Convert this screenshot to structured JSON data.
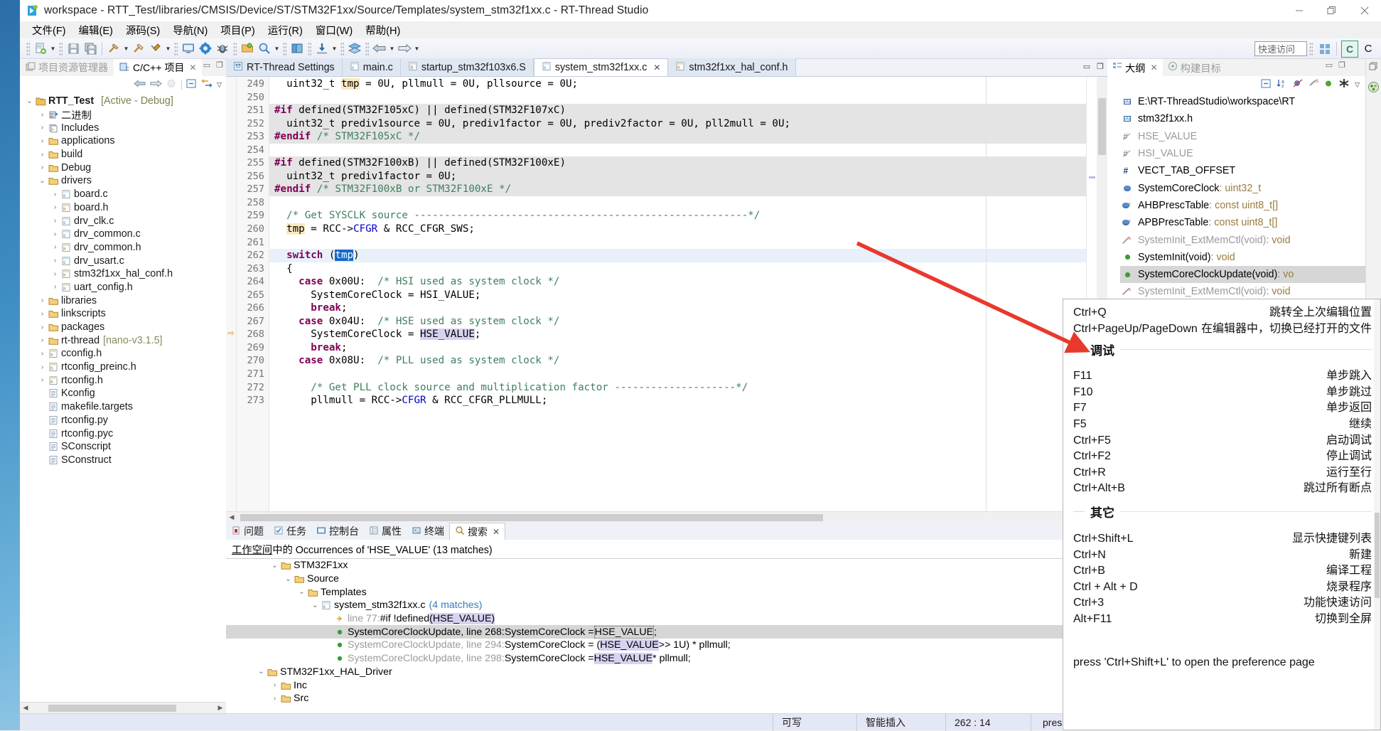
{
  "window": {
    "title": "workspace - RTT_Test/libraries/CMSIS/Device/ST/STM32F1xx/Source/Templates/system_stm32f1xx.c - RT-Thread Studio",
    "minimize": "—",
    "maximize": "❐",
    "close": "✕"
  },
  "menubar": {
    "items": [
      {
        "label": "文件(F)"
      },
      {
        "label": "编辑(E)"
      },
      {
        "label": "源码(S)"
      },
      {
        "label": "导航(N)"
      },
      {
        "label": "项目(P)"
      },
      {
        "label": "运行(R)"
      },
      {
        "label": "窗口(W)"
      },
      {
        "label": "帮助(H)"
      }
    ]
  },
  "toolbar": {
    "quick_access_placeholder": "快速访问",
    "icons": [
      "new-file-icon",
      "save-icon",
      "save-all-icon",
      "build-hammer-icon",
      "clean-icon",
      "build-config-icon",
      "terminal-icon",
      "settings-gear-icon",
      "debug-bug-icon",
      "open-resource-icon",
      "search-icon",
      "book-icon",
      "download-icon",
      "layers-icon",
      "back-arrow-icon",
      "forward-arrow-icon"
    ],
    "perspective_labels": [
      "C",
      "C"
    ]
  },
  "left_panel": {
    "tabs": [
      {
        "label": "项目资源管理器",
        "active": false,
        "icon": "project-explorer-icon"
      },
      {
        "label": "C/C++ 项目",
        "active": true,
        "icon": "cpp-project-icon"
      }
    ],
    "view_toolbar": [
      "back-arrow-icon",
      "forward-arrow-icon",
      "home-icon",
      "collapse-all-icon",
      "link-editor-icon",
      "view-menu-icon"
    ],
    "tree": [
      {
        "indent": 0,
        "twisty": "down",
        "icon": "project-icon",
        "label": "RTT_Test",
        "bold": true,
        "suffix": "[Active - Debug]"
      },
      {
        "indent": 1,
        "twisty": "right",
        "icon": "binaries-icon",
        "label": "二进制"
      },
      {
        "indent": 1,
        "twisty": "right",
        "icon": "includes-icon",
        "label": "Includes"
      },
      {
        "indent": 1,
        "twisty": "right",
        "icon": "folder-icon",
        "label": "applications"
      },
      {
        "indent": 1,
        "twisty": "right",
        "icon": "folder-icon",
        "label": "build"
      },
      {
        "indent": 1,
        "twisty": "right",
        "icon": "folder-icon",
        "label": "Debug"
      },
      {
        "indent": 1,
        "twisty": "down",
        "icon": "folder-icon",
        "label": "drivers"
      },
      {
        "indent": 2,
        "twisty": "right",
        "icon": "c-file-icon",
        "label": "board.c"
      },
      {
        "indent": 2,
        "twisty": "right",
        "icon": "h-file-icon",
        "label": "board.h"
      },
      {
        "indent": 2,
        "twisty": "right",
        "icon": "c-file-icon",
        "label": "drv_clk.c"
      },
      {
        "indent": 2,
        "twisty": "right",
        "icon": "c-file-icon",
        "label": "drv_common.c"
      },
      {
        "indent": 2,
        "twisty": "right",
        "icon": "h-file-icon",
        "label": "drv_common.h"
      },
      {
        "indent": 2,
        "twisty": "right",
        "icon": "c-file-icon",
        "label": "drv_usart.c"
      },
      {
        "indent": 2,
        "twisty": "right",
        "icon": "h-file-icon",
        "label": "stm32f1xx_hal_conf.h"
      },
      {
        "indent": 2,
        "twisty": "right",
        "icon": "h-file-icon",
        "label": "uart_config.h"
      },
      {
        "indent": 1,
        "twisty": "right",
        "icon": "folder-icon",
        "label": "libraries"
      },
      {
        "indent": 1,
        "twisty": "right",
        "icon": "folder-icon",
        "label": "linkscripts"
      },
      {
        "indent": 1,
        "twisty": "right",
        "icon": "folder-icon",
        "label": "packages"
      },
      {
        "indent": 1,
        "twisty": "right",
        "icon": "folder-icon",
        "label": "rt-thread",
        "suffix2": "[nano-v3.1.5]"
      },
      {
        "indent": 1,
        "twisty": "right",
        "icon": "h-file-icon",
        "label": "cconfig.h"
      },
      {
        "indent": 1,
        "twisty": "right",
        "icon": "h-file-icon",
        "label": "rtconfig_preinc.h"
      },
      {
        "indent": 1,
        "twisty": "right",
        "icon": "h-file-icon",
        "label": "rtconfig.h"
      },
      {
        "indent": 1,
        "twisty": "none",
        "icon": "text-file-icon",
        "label": "Kconfig"
      },
      {
        "indent": 1,
        "twisty": "none",
        "icon": "text-file-icon",
        "label": "makefile.targets"
      },
      {
        "indent": 1,
        "twisty": "none",
        "icon": "text-file-icon",
        "label": "rtconfig.py"
      },
      {
        "indent": 1,
        "twisty": "none",
        "icon": "text-file-icon",
        "label": "rtconfig.pyc"
      },
      {
        "indent": 1,
        "twisty": "none",
        "icon": "text-file-icon",
        "label": "SConscript"
      },
      {
        "indent": 1,
        "twisty": "none",
        "icon": "text-file-icon",
        "label": "SConstruct"
      }
    ]
  },
  "editor": {
    "tabs": [
      {
        "label": "RT-Thread Settings",
        "icon": "settings-file-icon",
        "active": false,
        "closable": false
      },
      {
        "label": "main.c",
        "icon": "c-file-icon",
        "active": false,
        "closable": false
      },
      {
        "label": "startup_stm32f103x6.S",
        "icon": "s-file-icon",
        "active": false,
        "closable": false
      },
      {
        "label": "system_stm32f1xx.c",
        "icon": "c-file-icon",
        "active": true,
        "closable": true
      },
      {
        "label": "stm32f1xx_hal_conf.h",
        "icon": "h-file-icon",
        "active": false,
        "closable": false
      }
    ],
    "first_line": 249,
    "lines": [
      {
        "n": 249,
        "shade": "none",
        "html": "  <s>uint32_t </s><o>tmp</o><s> = 0U, pllmull = 0U, pllsource = 0U;</s>"
      },
      {
        "n": 250,
        "shade": "none",
        "html": ""
      },
      {
        "n": 251,
        "shade": "grey",
        "html": "<k>#if</k><s> defined(STM32F105xC) || defined(STM32F107xC)</s>"
      },
      {
        "n": 252,
        "shade": "grey",
        "html": "  <s>uint32_t prediv1source = 0U, prediv1factor = 0U, prediv2factor = 0U, pll2mull = 0U;</s>"
      },
      {
        "n": 253,
        "shade": "grey",
        "html": "<k>#endif</k><s> </s><c>/* STM32F105xC */</c>"
      },
      {
        "n": 254,
        "shade": "none",
        "html": ""
      },
      {
        "n": 255,
        "shade": "grey",
        "html": "<k>#if</k><s> defined(STM32F100xB) || defined(STM32F100xE)</s>"
      },
      {
        "n": 256,
        "shade": "grey",
        "html": "  <s>uint32_t prediv1factor = 0U;</s>"
      },
      {
        "n": 257,
        "shade": "grey",
        "html": "<k>#endif</k><s> </s><c>/* STM32F100xB or STM32F100xE */</c>"
      },
      {
        "n": 258,
        "shade": "none",
        "html": ""
      },
      {
        "n": 259,
        "shade": "none",
        "html": "  <c>/* Get SYSCLK source -------------------------------------------------------*/</c>"
      },
      {
        "n": 260,
        "shade": "none",
        "html": "  <o>tmp</o><s> = RCC-&gt;</s><f>CFGR</f><s> &amp; RCC_CFGR_SWS;</s>"
      },
      {
        "n": 261,
        "shade": "none",
        "html": ""
      },
      {
        "n": 262,
        "shade": "cursor",
        "html": "  <k>switch</k><s> (</s><sel>tmp</sel><s>)</s>"
      },
      {
        "n": 263,
        "shade": "none",
        "html": "  <s>{</s>"
      },
      {
        "n": 264,
        "shade": "none",
        "html": "    <k>case</k><s> 0x00U:  </s><c>/* HSI used as system clock */</c>"
      },
      {
        "n": 265,
        "shade": "none",
        "html": "      <s>SystemCoreClock = HSI_VALUE;</s>"
      },
      {
        "n": 266,
        "shade": "none",
        "html": "      <k>break</k><s>;</s>"
      },
      {
        "n": 267,
        "shade": "none",
        "html": "    <k>case</k><s> 0x04U:  </s><c>/* HSE used as system clock */</c>"
      },
      {
        "n": 268,
        "shade": "none",
        "marker": "arrow",
        "html": "      <s>SystemCoreClock = </s><h>HSE_VALUE</h><s>;</s>"
      },
      {
        "n": 269,
        "shade": "none",
        "html": "      <k>break</k><s>;</s>"
      },
      {
        "n": 270,
        "shade": "none",
        "html": "    <k>case</k><s> 0x08U:  </s><c>/* PLL used as system clock */</c>"
      },
      {
        "n": 271,
        "shade": "none",
        "html": ""
      },
      {
        "n": 272,
        "shade": "none",
        "html": "      <c>/* Get PLL clock source and multiplication factor --------------------*/</c>"
      },
      {
        "n": 273,
        "shade": "none",
        "html": "      <s>pllmull = RCC-&gt;</s><f>CFGR</f><s> &amp; RCC_CFGR_PLLMULL;</s>"
      }
    ]
  },
  "bottom_panel": {
    "tabs": [
      {
        "label": "问题",
        "icon": "problems-icon",
        "active": false
      },
      {
        "label": "任务",
        "icon": "tasks-icon",
        "active": false
      },
      {
        "label": "控制台",
        "icon": "console-icon",
        "active": false
      },
      {
        "label": "属性",
        "icon": "properties-icon",
        "active": false
      },
      {
        "label": "终端",
        "icon": "terminal-icon",
        "active": false
      },
      {
        "label": "搜索",
        "icon": "search-icon",
        "active": true
      }
    ],
    "search_header_scope": "工作空间",
    "search_header_rest": "中的 Occurrences of 'HSE_VALUE' (13 matches)",
    "results": [
      {
        "indent": 3,
        "twisty": "down",
        "icon": "folder-icon",
        "label": "STM32F1xx"
      },
      {
        "indent": 4,
        "twisty": "down",
        "icon": "folder-icon",
        "label": "Source"
      },
      {
        "indent": 5,
        "twisty": "down",
        "icon": "folder-icon",
        "label": "Templates"
      },
      {
        "indent": 6,
        "twisty": "down",
        "icon": "c-file-icon",
        "label": "system_stm32f1xx.c",
        "count": "(4 matches)"
      },
      {
        "indent": 7,
        "twisty": "none",
        "icon": "jump-icon",
        "grey": true,
        "label": "line 77:",
        "text_black": " #if !defined ",
        "text_hl": "(HSE_VALUE)"
      },
      {
        "indent": 7,
        "twisty": "none",
        "icon": "green-dot-icon",
        "selected": true,
        "label": "SystemCoreClockUpdate, line 268:",
        "text_black": " SystemCoreClock = ",
        "text_boxed": "HSE_VALUE",
        "text_tail": ";"
      },
      {
        "indent": 7,
        "twisty": "none",
        "icon": "green-dot-icon",
        "grey": true,
        "label": "SystemCoreClockUpdate, line 294:",
        "text_black": " SystemCoreClock = (",
        "text_hl": "HSE_VALUE",
        "text_tail": " >> 1U) * pllmull;"
      },
      {
        "indent": 7,
        "twisty": "none",
        "icon": "green-dot-icon",
        "grey": true,
        "label": "SystemCoreClockUpdate, line 298:",
        "text_black": " SystemCoreClock = ",
        "text_hl": "HSE_VALUE",
        "text_tail": " * pllmull;"
      },
      {
        "indent": 2,
        "twisty": "down",
        "icon": "folder-icon",
        "label": "STM32F1xx_HAL_Driver"
      },
      {
        "indent": 3,
        "twisty": "right",
        "icon": "folder-icon",
        "label": "Inc"
      },
      {
        "indent": 3,
        "twisty": "right",
        "icon": "folder-icon",
        "label": "Src"
      }
    ]
  },
  "right_panel": {
    "tabs": [
      {
        "label": "大纲",
        "icon": "outline-icon",
        "active": true,
        "closable": true
      },
      {
        "label": "构建目标",
        "icon": "build-target-icon",
        "active": false,
        "closable": false
      }
    ],
    "toolbar_icons": [
      "collapse-all-icon",
      "sort-az-icon",
      "hide-fields-icon",
      "hide-static-icon",
      "hide-nonpublic-icon",
      "hide-local-icon",
      "view-menu-icon"
    ],
    "items": [
      {
        "icon": "include-icon",
        "label": "E:\\RT-ThreadStudio\\workspace\\RT",
        "type": "",
        "grey": false
      },
      {
        "icon": "include-icon",
        "label": "stm32f1xx.h",
        "type": "",
        "grey": false
      },
      {
        "icon": "macro-static-icon",
        "label": "HSE_VALUE",
        "type": "",
        "grey": true
      },
      {
        "icon": "macro-static-icon",
        "label": "HSI_VALUE",
        "type": "",
        "grey": true
      },
      {
        "icon": "macro-icon",
        "label": "VECT_TAB_OFFSET",
        "type": "",
        "grey": false
      },
      {
        "icon": "variable-icon",
        "label": "SystemCoreClock",
        "type": " : uint32_t",
        "grey": false
      },
      {
        "icon": "variable-const-icon",
        "label": "AHBPrescTable",
        "type": " : const uint8_t[]",
        "grey": false
      },
      {
        "icon": "variable-const-icon",
        "label": "APBPrescTable",
        "type": " : const uint8_t[]",
        "grey": false
      },
      {
        "icon": "function-static-icon",
        "label": "SystemInit_ExtMemCtl(void)",
        "type": " : void",
        "grey": true
      },
      {
        "icon": "function-icon",
        "label": "SystemInit(void)",
        "type": " : void",
        "grey": false
      },
      {
        "icon": "function-icon",
        "label": "SystemCoreClockUpdate(void)",
        "type": " : vo",
        "grey": false,
        "selected": true
      },
      {
        "icon": "function-static-icon",
        "label": "SystemInit_ExtMemCtl(void)",
        "type": " : void",
        "grey": true
      }
    ]
  },
  "statusbar": {
    "writable": "可写",
    "insert_mode": "智能插入",
    "position": "262 : 14",
    "message": "press 'Ctrl+Shift+L' to open the preference page"
  },
  "shortcut_popup": {
    "rows_top": [
      {
        "key": "Ctrl+Q",
        "desc": "跳转全上次编辑位置"
      },
      {
        "key": "Ctrl+PageUp/PageDown",
        "desc": "在编辑器中，切换已经打开的文件"
      }
    ],
    "section_debug": "调试",
    "rows_debug": [
      {
        "key": "F11",
        "desc": "单步跳入"
      },
      {
        "key": "F10",
        "desc": "单步跳过"
      },
      {
        "key": "F7",
        "desc": "单步返回"
      },
      {
        "key": "F5",
        "desc": "继续"
      },
      {
        "key": "Ctrl+F5",
        "desc": "启动调试"
      },
      {
        "key": "Ctrl+F2",
        "desc": "停止调试"
      },
      {
        "key": "Ctrl+R",
        "desc": "运行至行"
      },
      {
        "key": "Ctrl+Alt+B",
        "desc": "跳过所有断点"
      }
    ],
    "section_other": "其它",
    "rows_other": [
      {
        "key": "Ctrl+Shift+L",
        "desc": "显示快捷键列表"
      },
      {
        "key": "Ctrl+N",
        "desc": "新建"
      },
      {
        "key": "Ctrl+B",
        "desc": "编译工程"
      },
      {
        "key": "Ctrl + Alt + D",
        "desc": "烧录程序"
      },
      {
        "key": "Ctrl+3",
        "desc": "功能快速访问"
      },
      {
        "key": "Alt+F11",
        "desc": "切换到全屏"
      }
    ],
    "footer": "press 'Ctrl+Shift+L' to open the preference page"
  },
  "annotation": {
    "arrow_color": "#e8392c"
  }
}
